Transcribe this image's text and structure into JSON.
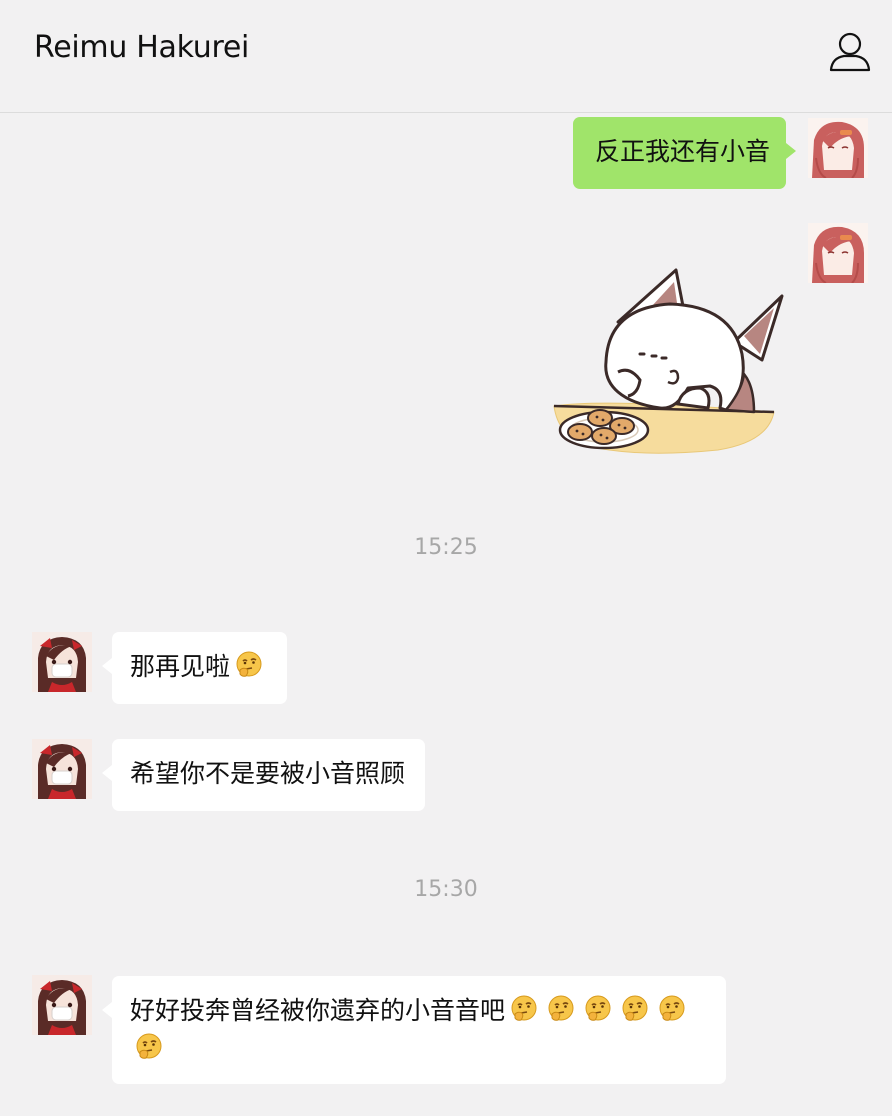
{
  "header": {
    "title": "Reimu Hakurei",
    "profile_icon": "person-outline-icon"
  },
  "messages": [
    {
      "side": "right",
      "text": "反正我还有小音"
    },
    {
      "side": "right",
      "type": "sticker",
      "sticker": "cat-eating-cookies-sticker"
    },
    {
      "type": "timestamp",
      "text": "15:25"
    },
    {
      "side": "left",
      "text": "那再见啦",
      "emoji_count": 1
    },
    {
      "side": "left",
      "text": "希望你不是要被小音照顾"
    },
    {
      "type": "timestamp",
      "text": "15:30"
    },
    {
      "side": "left",
      "text": "好好投奔曾经被你遗弃的小音音吧",
      "emoji_count": 6
    }
  ],
  "colors": {
    "background": "#f2f1f2",
    "bubble_sent": "#a0e46a",
    "bubble_received": "#ffffff",
    "timestamp": "#a7a7a7"
  },
  "emoji": "thinking-face-emoji"
}
